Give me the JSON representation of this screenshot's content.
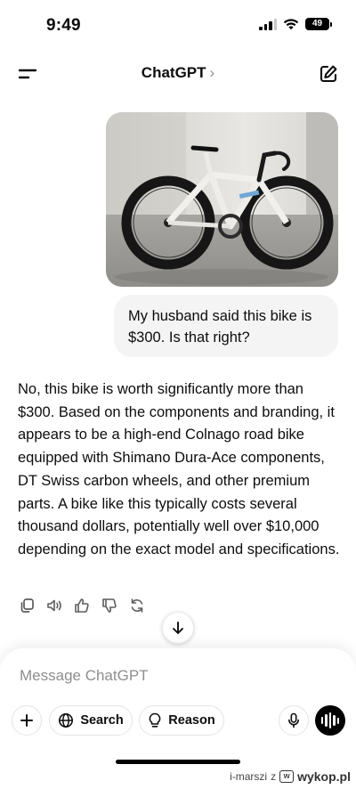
{
  "status_bar": {
    "time": "9:49",
    "battery_level": "49",
    "icons": [
      "signal-icon",
      "wifi-icon",
      "battery-icon"
    ]
  },
  "header": {
    "title": "ChatGPT",
    "title_chevron": "›",
    "icons": [
      "menu-icon",
      "new-chat-icon"
    ]
  },
  "conversation": {
    "user_image_alt": "photo-bike",
    "user_message": "My husband said this bike is $300. Is that right?",
    "assistant_message": "No, this bike is worth significantly more than $300. Based on the components and branding, it appears to be a high-end Colnago road bike equipped with Shimano Dura-Ace components, DT Swiss carbon wheels, and other premium parts. A bike like this typically costs several thousand dollars, potentially well over $10,000 depending on the exact model and specifications.",
    "actions": [
      "copy-icon",
      "read-aloud-icon",
      "thumbs-up-icon",
      "thumbs-down-icon",
      "regenerate-icon"
    ]
  },
  "composer": {
    "placeholder": "Message ChatGPT",
    "search_label": "Search",
    "reason_label": "Reason",
    "icons": [
      "plus-icon",
      "globe-icon",
      "lightbulb-icon",
      "microphone-icon",
      "voice-mode-icon"
    ]
  },
  "watermark": {
    "user": "i-marszi",
    "connector": "z",
    "brand": "wykop.pl"
  },
  "colors": {
    "user_bubble": "#f4f4f4",
    "text": "#0d0d0d",
    "placeholder": "#8e8e8e",
    "voice_button": "#000000"
  }
}
